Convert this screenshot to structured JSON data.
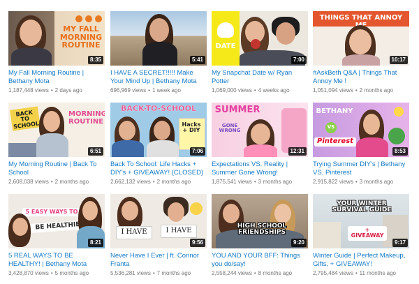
{
  "videos": [
    {
      "title": "My Fall Morning Routine | Bethany Mota",
      "views": "1,187,448 views",
      "age": "2 days ago",
      "duration": "8:35",
      "overlay": "MY FALL MORNING ROUTINE"
    },
    {
      "title": "I HAVE A SECRET!!!!! Make Your Mind Up | Bethany Mota Book",
      "views": "696,969 views",
      "age": "1 week ago",
      "duration": "5:41",
      "overlay": ""
    },
    {
      "title": "My Snapchat Date w/ Ryan Potter",
      "views": "1,069,000 views",
      "age": "4 weeks ago",
      "duration": "7:00",
      "overlay": "DATE"
    },
    {
      "title": "#AskBeth Q&A | Things That Annoy Me !",
      "views": "1,051,094 views",
      "age": "2 months ago",
      "duration": "10:17",
      "overlay": "THINGS THAT ANNOY ME"
    },
    {
      "title": "My Morning Routine | Back To School",
      "views": "2,608,038 views",
      "age": "2 months ago",
      "duration": "6:51",
      "overlay": "MORNING ROUTINE",
      "overlay2": "BACK TO SCHOOL"
    },
    {
      "title": "Back To School: Life Hacks + DIY's + GIVEAWAY! (CLOSED)",
      "views": "2,662,132 views",
      "age": "2 months ago",
      "duration": "7:06",
      "overlay": "BACK-TO-SCHOOL",
      "overlay2": "Hacks + DIY"
    },
    {
      "title": "Expectations VS. Reality | Summer Gone Wrong!",
      "views": "1,875,541 views",
      "age": "3 months ago",
      "duration": "12:31",
      "overlay": "SUMMER",
      "overlay2": "GONE WRONG"
    },
    {
      "title": "Trying Summer DIY's | Bethany VS. Pinterest",
      "views": "2,915,822 views",
      "age": "3 months ago",
      "duration": "8:53",
      "overlay": "BETHANY",
      "overlay2": "Pinterest",
      "overlay3": "VS"
    },
    {
      "title": "5 REAL WAYS TO BE HEALTHY! | Bethany Mota",
      "views": "3,428,870 views",
      "age": "5 months ago",
      "duration": "8:21",
      "overlay": "5 EASY WAYS TO",
      "overlay2": "BE HEALTHIER"
    },
    {
      "title": "Never Have I Ever | ft. Connor Franta",
      "views": "5,536,281 views",
      "age": "7 months ago",
      "duration": "9:56",
      "overlay": "I HAVE",
      "overlay2": "I HAVE"
    },
    {
      "title": "YOU AND YOUR BFF: Things you do/say!",
      "views": "2,558,244 views",
      "age": "8 months ago",
      "duration": "9:20",
      "overlay": "HIGH SCHOOL FRIENDSHIPS"
    },
    {
      "title": "Winter Guide | Perfect Makeup, Gifts, + GIVEAWAY!",
      "views": "2,795,484 views",
      "age": "11 months ago",
      "duration": "9:17",
      "overlay": "YOUR WINTER SURVIVAL GUIDE",
      "overlay2": "+ GIVEAWAY"
    }
  ],
  "colors": {
    "link": "#167ac6",
    "meta": "#767676",
    "badge": "#000000"
  }
}
